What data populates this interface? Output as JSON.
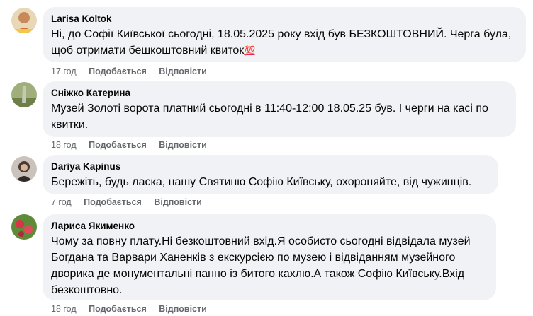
{
  "comments": [
    {
      "author": "Larisa Koltok",
      "text": "Ні, до Софії Київської сьогодні, 18.05.2025 року вхід був БЕЗКОШТОВНИЙ. Черга була, щоб отримати бешкоштовний квиток",
      "emoji": "💯",
      "time": "17 год",
      "like_label": "Подобається",
      "reply_label": "Відповісти"
    },
    {
      "author": "Сніжко Катерина",
      "text": "Музей Золоті ворота платний сьогодні в 11:40-12:00 18.05.25 був. І черги на касі по квитки.",
      "time": "18 год",
      "like_label": "Подобається",
      "reply_label": "Відповісти"
    },
    {
      "author": "Dariya Kapinus",
      "text": "Бережіть, будь ласка, нашу Святиню Софію Київську, охороняйте, від чужинців.",
      "time": "7 год",
      "like_label": "Подобається",
      "reply_label": "Відповісти"
    },
    {
      "author": "Лариса Якименко",
      "text": "Чому за повну плату.Ні безкоштовний вхід.Я особисто сьогодні відвідала музей Богдана та Варвари Ханенків з екскурсією по музею і відвіданням музейного дворика де монументальні панно із битого кахлю.А також Софію Київську.Вхід безкоштовно.",
      "time": "18 год",
      "like_label": "Подобається",
      "reply_label": "Відповісти"
    }
  ],
  "colors": {
    "bubble": "#f0f2f5",
    "meta": "#65676b",
    "text": "#050505"
  }
}
